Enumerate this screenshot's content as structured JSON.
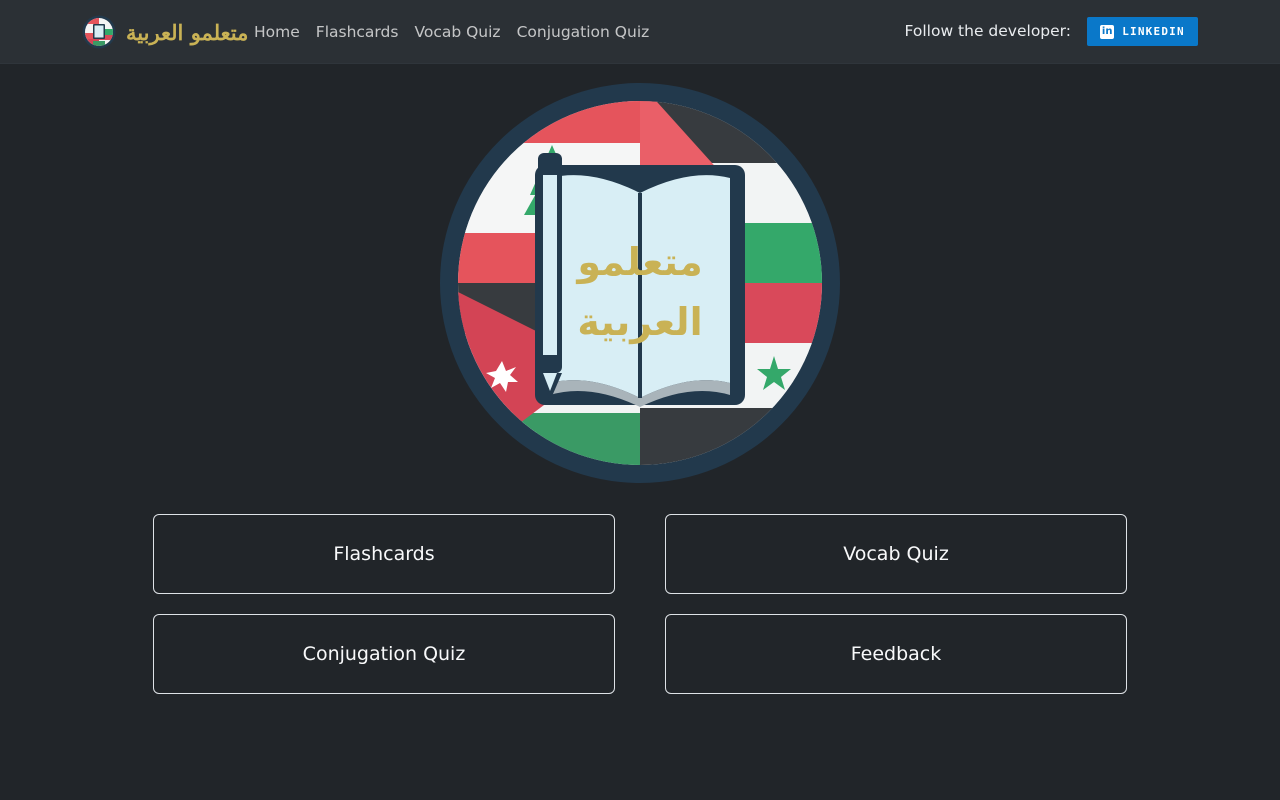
{
  "brand": {
    "name": "متعلمو العربية",
    "logo_icon": "book-flags-logo-icon"
  },
  "nav": {
    "items": [
      {
        "label": "Home"
      },
      {
        "label": "Flashcards"
      },
      {
        "label": "Vocab Quiz"
      },
      {
        "label": "Conjugation Quiz"
      }
    ]
  },
  "social": {
    "follow_text": "Follow the developer:",
    "linkedin_label": "LINKEDIN",
    "linkedin_icon": "linkedin-icon"
  },
  "hero": {
    "logo_icon": "open-book-pencil-flags-icon",
    "title_line1": "متعلمو",
    "title_line2": "العربية"
  },
  "tiles": [
    {
      "label": "Flashcards"
    },
    {
      "label": "Vocab Quiz"
    },
    {
      "label": "Conjugation Quiz"
    },
    {
      "label": "Feedback"
    }
  ],
  "colors": {
    "background": "#212529",
    "navbar": "#2b3035",
    "brand_gold": "#c9b255",
    "linkedin_blue": "#0a78c9",
    "ring": "#22394c"
  }
}
